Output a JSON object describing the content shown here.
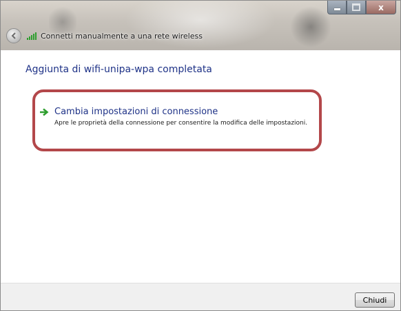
{
  "window": {
    "title": "Connetti manualmente a una rete wireless",
    "caption_buttons": {
      "minimize": "",
      "maximize": "",
      "close": "x"
    }
  },
  "content": {
    "heading": "Aggiunta di wifi-unipa-wpa completata",
    "task": {
      "title": "Cambia impostazioni di connessione",
      "description": "Apre le proprietà della connessione per consentire la modifica delle impostazioni."
    }
  },
  "footer": {
    "close_label": "Chiudi"
  },
  "colors": {
    "link_text": "#1e3287",
    "highlight_border": "#b3474a",
    "arrow_green": "#2e9e2e"
  },
  "icons": [
    "back-arrow-icon",
    "wifi-signal-icon",
    "green-arrow-icon"
  ]
}
